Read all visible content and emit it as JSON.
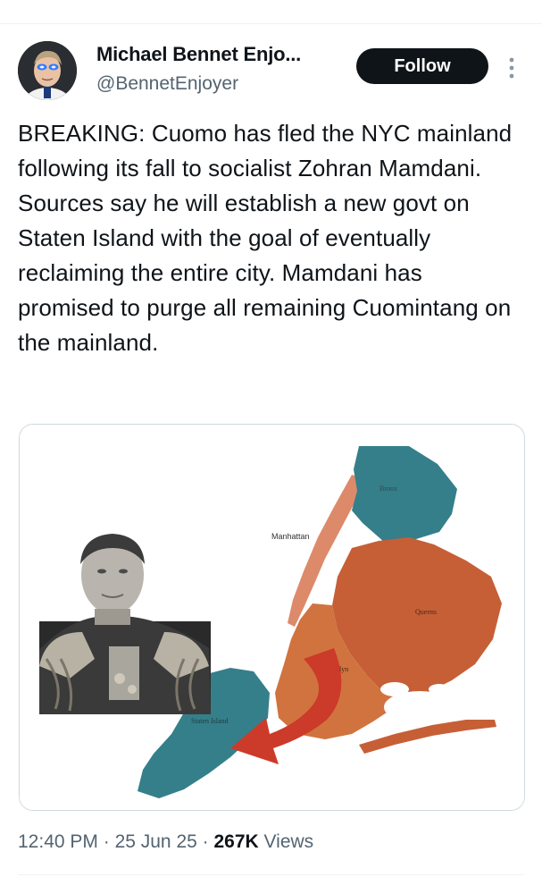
{
  "author": {
    "display_name": "Michael Bennet Enjo...",
    "handle": "@BennetEnjoyer"
  },
  "follow_label": "Follow",
  "tweet_text": "BREAKING: Cuomo has fled the NYC mainland following its fall to socialist Zohran Mamdani. Sources say he will establish a new govt on Staten Island with the goal of eventually reclaiming the entire city. Mamdani has promised to purge all remaining Cuomintang on the mainland.",
  "media": {
    "map_labels": {
      "bronx": "Bronx",
      "manhattan": "Manhattan",
      "queens": "Queens",
      "brooklyn_partial": "lyn",
      "staten_island": "Staten Island"
    },
    "colors": {
      "bronx": "#357f8a",
      "staten_island": "#357f8a",
      "manhattan": "#dd8a6a",
      "queens": "#c65f36",
      "brooklyn": "#d1733f",
      "arrow": "#cc3a2a"
    }
  },
  "meta": {
    "time": "12:40 PM",
    "date": "25 Jun 25",
    "views_count": "267K",
    "views_label": "Views",
    "separator": " · "
  }
}
